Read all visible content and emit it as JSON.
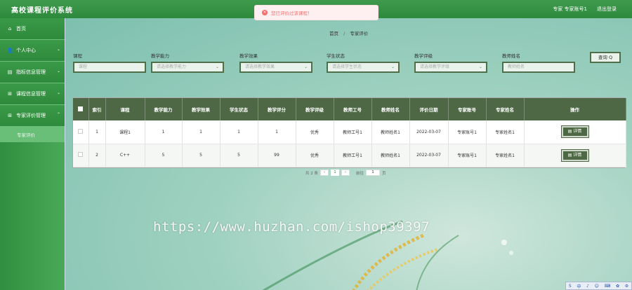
{
  "header": {
    "title": "高校课程评价系统",
    "user": "专家 专家账号1",
    "logout": "退出登录"
  },
  "toast": {
    "message": "您已评价过该课程！"
  },
  "sidebar": {
    "items": [
      {
        "label": "首页",
        "icon": "home-icon",
        "glyph": "⌂",
        "chev": ""
      },
      {
        "label": "个人中心",
        "icon": "user-icon",
        "glyph": "👤",
        "chev": "⌄"
      },
      {
        "label": "指标信息管理",
        "icon": "list-icon",
        "glyph": "▤",
        "chev": "⌄"
      },
      {
        "label": "课程信息管理",
        "icon": "grid-icon",
        "glyph": "⊞",
        "chev": "⌄"
      },
      {
        "label": "专家评价管理",
        "icon": "grid-icon",
        "glyph": "⊞",
        "chev": "⌃"
      }
    ],
    "submenu": "专家评价"
  },
  "breadcrumb": {
    "home": "首页",
    "sep": "/",
    "current": "专家评价"
  },
  "filters": [
    {
      "label": "课程",
      "placeholder": "课程",
      "dropdown": false
    },
    {
      "label": "教学能力",
      "placeholder": "请选择教学能力",
      "dropdown": true
    },
    {
      "label": "教学效果",
      "placeholder": "请选择教学效果",
      "dropdown": true
    },
    {
      "label": "学生状态",
      "placeholder": "请选择学生状态",
      "dropdown": true
    },
    {
      "label": "教学评级",
      "placeholder": "请选择教学评级",
      "dropdown": true
    },
    {
      "label": "教师姓名",
      "placeholder": "教师姓名",
      "dropdown": false
    }
  ],
  "query_button": "查询 Q",
  "table": {
    "columns": [
      "索引",
      "课程",
      "教学能力",
      "教学效果",
      "学生状态",
      "教学评分",
      "教学评级",
      "教师工号",
      "教师姓名",
      "评价日期",
      "专家账号",
      "专家姓名",
      "操作"
    ],
    "rows": [
      [
        "1",
        "课程1",
        "1",
        "1",
        "1",
        "1",
        "优秀",
        "教师工号1",
        "教师姓名1",
        "2022-03-07",
        "专家账号1",
        "专家姓名1"
      ],
      [
        "2",
        "C++",
        "5",
        "5",
        "5",
        "99",
        "优秀",
        "教师工号1",
        "教师姓名1",
        "2022-03-07",
        "专家账号1",
        "专家姓名1"
      ]
    ],
    "action_label": "▤ 详情"
  },
  "pager": {
    "total": "共 2 条",
    "prev": "‹",
    "page": "1",
    "next": "›",
    "goto": "前往",
    "goto_value": "1",
    "unit": "页"
  },
  "watermark": "https://www.huzhan.com/ishop39397",
  "tray": [
    "S",
    "中",
    "♪",
    "☺",
    "⌨",
    "✿",
    "⚙"
  ]
}
